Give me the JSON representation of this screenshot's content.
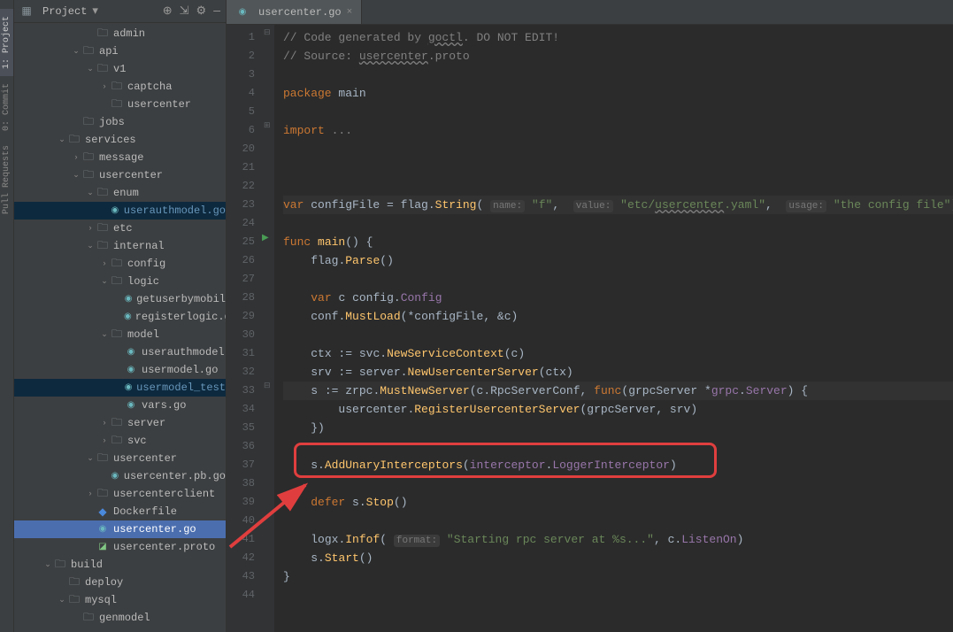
{
  "sidebar_tabs": {
    "project": "1: Project",
    "commit": "0: Commit",
    "pull_requests": "Pull Requests"
  },
  "project_header": {
    "title": "Project"
  },
  "tree": {
    "admin": "admin",
    "api": "api",
    "v1": "v1",
    "captcha": "captcha",
    "usercenter_folder": "usercenter",
    "jobs": "jobs",
    "services": "services",
    "message": "message",
    "usercenter_svc": "usercenter",
    "enum": "enum",
    "userauthmodel_go": "userauthmodel.go",
    "etc": "etc",
    "internal": "internal",
    "config": "config",
    "logic": "logic",
    "getuserbymobil": "getuserbymobil",
    "registerlogic": "registerlogic.go",
    "model": "model",
    "userauthmodel": "userauthmodel",
    "usermodel_go": "usermodel.go",
    "usermodel_test": "usermodel_test",
    "vars_go": "vars.go",
    "server": "server",
    "svc": "svc",
    "usercenter_dir": "usercenter",
    "usercenter_pb_go": "usercenter.pb.go",
    "usercenterclient": "usercenterclient",
    "dockerfile": "Dockerfile",
    "usercenter_go": "usercenter.go",
    "usercenter_proto": "usercenter.proto",
    "build": "build",
    "deploy": "deploy",
    "mysql": "mysql",
    "genmodel": "genmodel"
  },
  "tabs": {
    "active": "usercenter.go"
  },
  "code": {
    "l1_comment": "// Code generated by ",
    "l1_goctl": "goctl",
    "l1_rest": ". DO NOT EDIT!",
    "l2_comment": "// Source: ",
    "l2_usercenter": "usercenter",
    "l2_proto": ".proto",
    "l4_package": "package",
    "l4_main": "main",
    "l6_import": "import",
    "l6_dots": "...",
    "l23_var": "var",
    "l23_configFile": "configFile",
    "l23_eq": " = ",
    "l23_flag": "flag",
    "l23_String": "String",
    "l23_name": "name:",
    "l23_f": "\"f\"",
    "l23_value": "value:",
    "l23_etc": "\"etc/",
    "l23_usercenter": "usercenter",
    "l23_yaml": ".yaml\"",
    "l23_usage": "usage:",
    "l23_config": "\"the config file\"",
    "l25_func": "func",
    "l25_main": "main",
    "l26_flag": "flag",
    "l26_Parse": "Parse",
    "l28_var": "var",
    "l28_c": "c",
    "l28_config": "config",
    "l28_Config": "Config",
    "l29_conf": "conf",
    "l29_MustLoad": "MustLoad",
    "l29_star": "*configFile",
    "l29_andc": "&c",
    "l31_ctx": "ctx",
    "l31_svc": "svc",
    "l31_NewServiceContext": "NewServiceContext",
    "l31_c": "c",
    "l32_srv": "srv",
    "l32_server": "server",
    "l32_NewUsercenterServer": "NewUsercenterServer",
    "l32_ctx": "ctx",
    "l33_s": "s",
    "l33_zrpc": "zrpc",
    "l33_MustNewServer": "MustNewServer",
    "l33_c_Rpc": "c.RpcServerConf",
    "l33_func": "func",
    "l33_grpcServer": "grpcServer",
    "l33_grpc": "grpc",
    "l33_Server": "Server",
    "l34_usercenter": "usercenter",
    "l34_Register": "RegisterUsercenterServer",
    "l34_grpcServer": "grpcServer",
    "l34_srv": "srv",
    "l37_s": "s",
    "l37_AddUnary": "AddUnaryInterceptors",
    "l37_interceptor": "interceptor",
    "l37_Logger": "LoggerInterceptor",
    "l39_defer": "defer",
    "l39_s": "s",
    "l39_Stop": "Stop",
    "l41_logx": "logx",
    "l41_Infof": "Infof",
    "l41_format": "format:",
    "l41_str": "\"Starting rpc server at %s...\"",
    "l41_c": "c",
    "l41_Listen": "ListenOn",
    "l42_s": "s",
    "l42_Start": "Start"
  },
  "line_numbers": [
    "1",
    "2",
    "3",
    "4",
    "5",
    "6",
    "20",
    "21",
    "22",
    "23",
    "24",
    "25",
    "26",
    "27",
    "28",
    "29",
    "30",
    "31",
    "32",
    "33",
    "34",
    "35",
    "36",
    "37",
    "38",
    "39",
    "40",
    "41",
    "42",
    "43",
    "44"
  ]
}
